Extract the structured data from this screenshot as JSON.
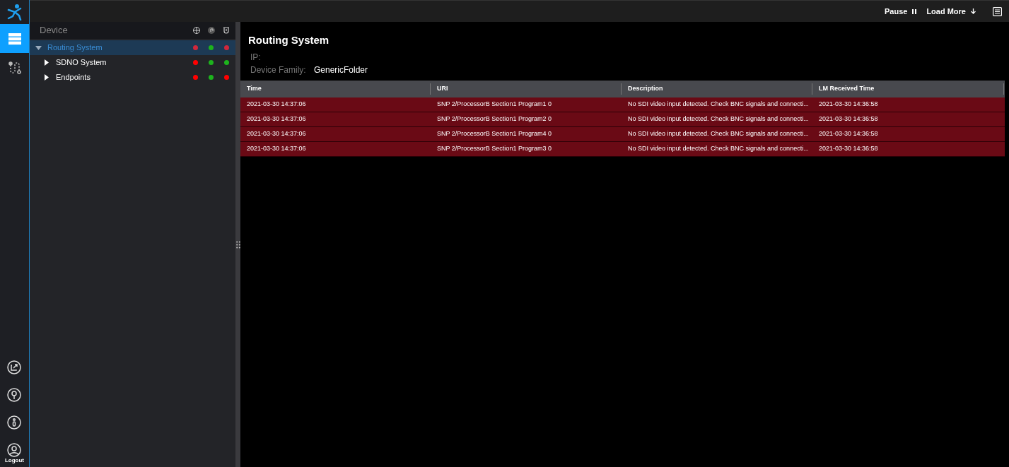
{
  "top_bar": {
    "pause": {
      "label": "Pause"
    },
    "load_more": {
      "label": "Load More"
    }
  },
  "nav": [
    {
      "kind": "devices",
      "selected": true
    },
    {
      "kind": "routing",
      "selected": false
    }
  ],
  "nav_bottom": {
    "logout": "Logout"
  },
  "tree": {
    "title": "Device",
    "items": [
      {
        "label": "Routing System",
        "expanded": true,
        "selected": true,
        "dots": [
          {
            "color": "#d0283c"
          },
          {
            "color": "#1db31d"
          },
          {
            "color": "#d0283c"
          }
        ],
        "children": [
          {
            "label": "SDNO System",
            "expanded": false,
            "selected": false,
            "dots": [
              {
                "color": "#ff0000"
              },
              {
                "color": "#1db31d"
              },
              {
                "color": "#1db31d"
              }
            ]
          },
          {
            "label": "Endpoints",
            "expanded": false,
            "selected": false,
            "dots": [
              {
                "color": "#ff0000"
              },
              {
                "color": "#1db31d"
              },
              {
                "color": "#ff0000"
              }
            ]
          }
        ]
      }
    ]
  },
  "detail": {
    "title": "Routing System",
    "fields": [
      {
        "label": "IP:"
      },
      {
        "label": "Device Family:",
        "value": "GenericFolder"
      }
    ]
  },
  "table": {
    "columns": [
      "Time",
      "URI",
      "Description",
      "LM Received Time"
    ],
    "rows": [
      [
        "2021-03-30 14:37:06",
        "SNP 2/ProcessorB Section1 Program1 0",
        "No SDI video input detected. Check BNC signals and connecti...",
        "2021-03-30 14:36:58"
      ],
      [
        "2021-03-30 14:37:06",
        "SNP 2/ProcessorB Section1 Program2 0",
        "No SDI video input detected. Check BNC signals and connecti...",
        "2021-03-30 14:36:58"
      ],
      [
        "2021-03-30 14:37:06",
        "SNP 2/ProcessorB Section1 Program4 0",
        "No SDI video input detected. Check BNC signals and connecti...",
        "2021-03-30 14:36:58"
      ],
      [
        "2021-03-30 14:37:06",
        "SNP 2/ProcessorB Section1 Program3 0",
        "No SDI video input detected. Check BNC signals and connecti...",
        "2021-03-30 14:36:58"
      ]
    ]
  }
}
